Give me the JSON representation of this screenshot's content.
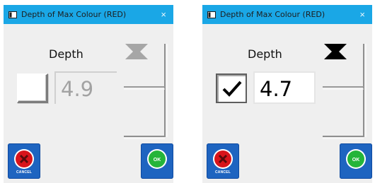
{
  "dialogs": [
    {
      "title": "Depth of Max Colour (RED)",
      "label": "Depth",
      "value": "4.9",
      "checked": false,
      "cancel_label": "CANCEL",
      "ok_label": "OK"
    },
    {
      "title": "Depth of Max Colour (RED)",
      "label": "Depth",
      "value": "4.7",
      "checked": true,
      "cancel_label": "CANCEL",
      "ok_label": "OK"
    }
  ],
  "colors": {
    "titlebar": "#1aa7e6",
    "button_blue": "#1e64c0",
    "cancel_red": "#d8141b",
    "ok_green": "#25b53a",
    "arrow_disabled": "#a6a6a6",
    "arrow_enabled": "#000000"
  },
  "icons": {
    "close": "×",
    "check": "check-icon",
    "up": "triangle-up-icon",
    "down": "triangle-down-icon",
    "cancel": "x-circle-icon",
    "ok": "ok-circle-icon"
  }
}
